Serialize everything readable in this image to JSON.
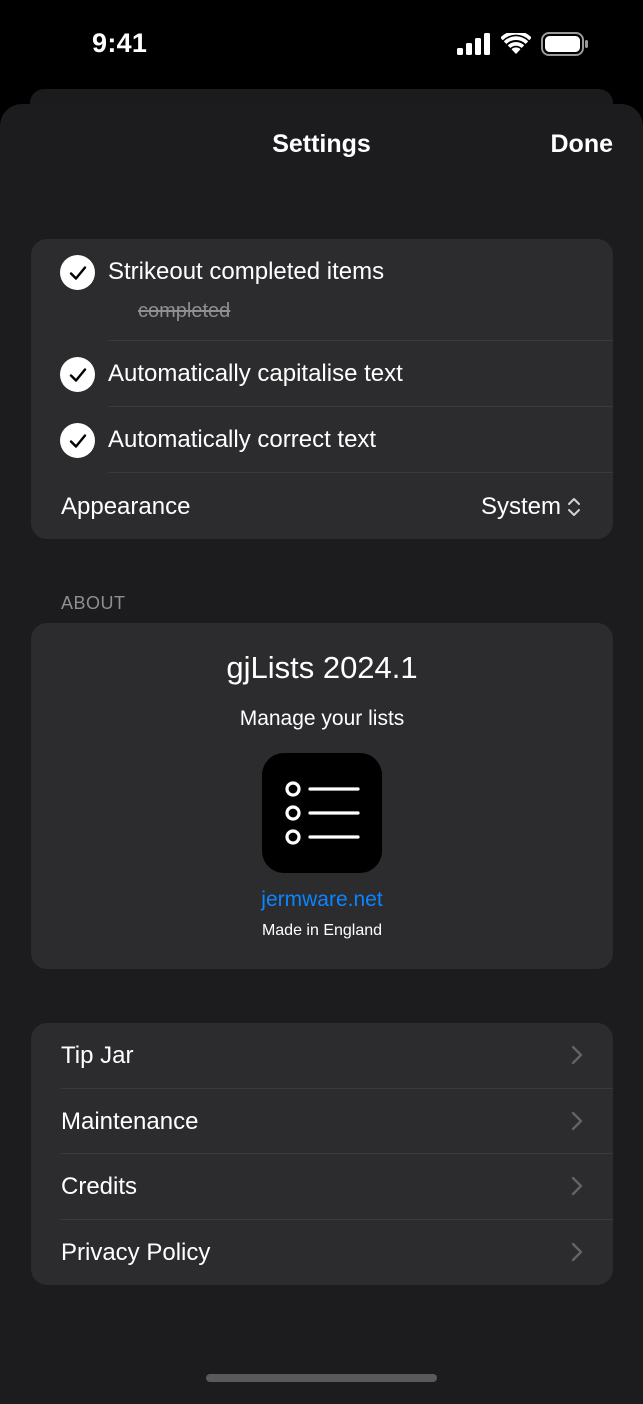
{
  "status_bar": {
    "time": "9:41"
  },
  "nav": {
    "title": "Settings",
    "done_label": "Done"
  },
  "preferences": {
    "strikeout": {
      "label": "Strikeout completed items",
      "sample": "completed",
      "checked": true
    },
    "capitalise": {
      "label": "Automatically capitalise text",
      "checked": true
    },
    "autocorrect": {
      "label": "Automatically correct text",
      "checked": true
    },
    "appearance": {
      "label": "Appearance",
      "value": "System"
    }
  },
  "about": {
    "header": "ABOUT",
    "title": "gjLists 2024.1",
    "subtitle": "Manage your lists",
    "link": "jermware.net",
    "made_in": "Made in England"
  },
  "links": [
    {
      "label": "Tip Jar"
    },
    {
      "label": "Maintenance"
    },
    {
      "label": "Credits"
    },
    {
      "label": "Privacy Policy"
    }
  ],
  "colors": {
    "background": "#000000",
    "sheet": "#1c1c1e",
    "group": "#2c2c2e",
    "accent_link": "#0a84ff",
    "secondary_text": "#8e8e93"
  }
}
